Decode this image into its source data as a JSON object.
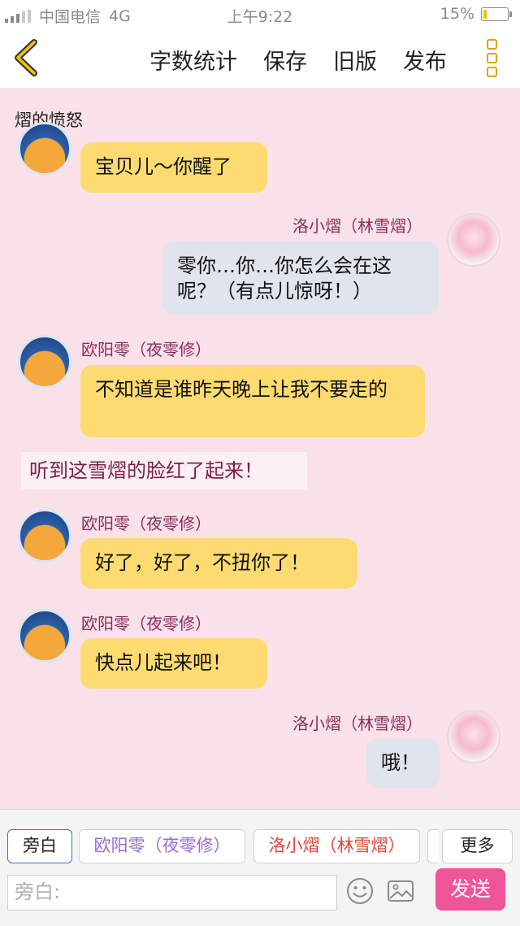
{
  "status_bar": {
    "carrier": "中国电信",
    "network": "4G",
    "time": "上午9:22",
    "battery": "15%",
    "battery_level": 0.15
  },
  "nav": {
    "back_icon": "chevron-left-icon",
    "actions": [
      "字数统计",
      "保存",
      "旧版",
      "发布"
    ],
    "more_icon": "vertical-dots-icon"
  },
  "title": "熠的愤怒",
  "messages": {
    "m1": {
      "text": "宝贝儿～你醒了"
    },
    "m2": {
      "sender": "洛小熠（林雪熠）",
      "text": "零你…你…你怎么会在这呢？（有点儿惊呀！）"
    },
    "m3": {
      "sender": "欧阳零（夜零修）",
      "text": "不知道是谁昨天晚上让我不要走的"
    },
    "narration": "听到这雪熠的脸红了起来！",
    "m4": {
      "sender": "欧阳零（夜零修）",
      "text": "好了，好了，不扭你了！"
    },
    "m5": {
      "sender": "欧阳零（夜零修）",
      "text": "快点儿起来吧！"
    },
    "m6": {
      "sender": "洛小熠（林雪熠）",
      "text": "哦！"
    }
  },
  "toolbar": {
    "chips": [
      "旁白",
      "欧阳零（夜零修）",
      "洛小熠（林雪熠）"
    ],
    "more_label": "更多",
    "input_placeholder": "旁白:",
    "emoji_icon": "smiley-icon",
    "image_icon": "image-icon",
    "send_label": "发送",
    "accent_color": "#f0559a",
    "bubble_yellow": "#fddb70",
    "bubble_gray": "#e0e4ec"
  }
}
